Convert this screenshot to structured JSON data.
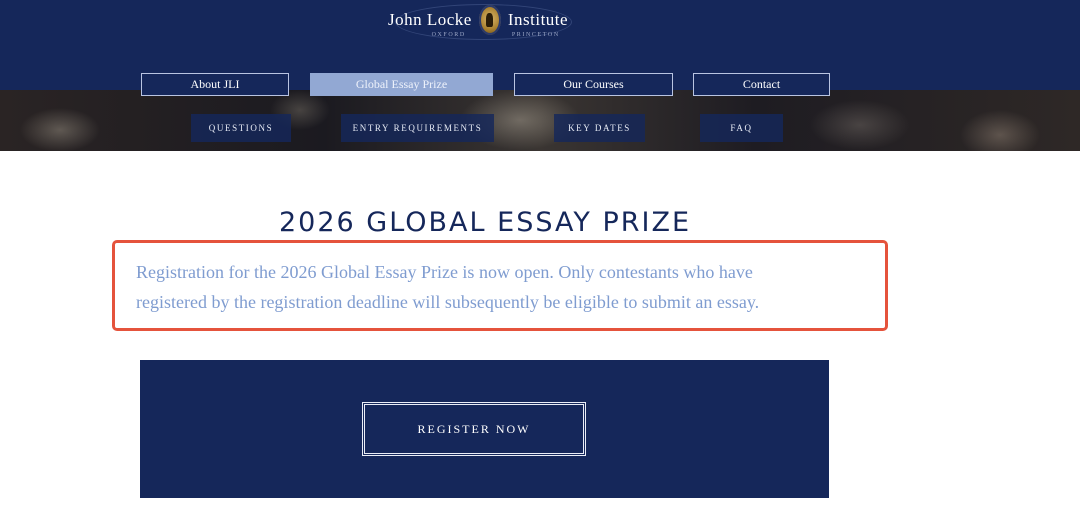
{
  "header": {
    "brand_left": "John Locke",
    "brand_right": "Institute",
    "sub_left": "OXFORD",
    "sub_right": "PRINCETON",
    "logo_icon": "medallion-portrait-icon",
    "colors": {
      "navy": "#15275a",
      "active_tab": "#92a8d3"
    }
  },
  "main_nav": [
    {
      "label": "About JLI",
      "active": false
    },
    {
      "label": "Global Essay Prize",
      "active": true
    },
    {
      "label": "Our Courses",
      "active": false
    },
    {
      "label": "Contact",
      "active": false
    }
  ],
  "sub_nav": [
    {
      "label": "QUESTIONS"
    },
    {
      "label": "ENTRY REQUIREMENTS"
    },
    {
      "label": "KEY DATES"
    },
    {
      "label": "FAQ"
    }
  ],
  "content": {
    "title": "2026 GLOBAL ESSAY PRIZE",
    "intro_line1": "Registration for the 2026 Global Essay Prize is now open.  Only contestants who have",
    "intro_line2": "registered by the registration deadline will subsequently be eligible to submit an essay.",
    "highlight_color": "#e5533c"
  },
  "cta": {
    "register_label": "REGISTER NOW"
  }
}
